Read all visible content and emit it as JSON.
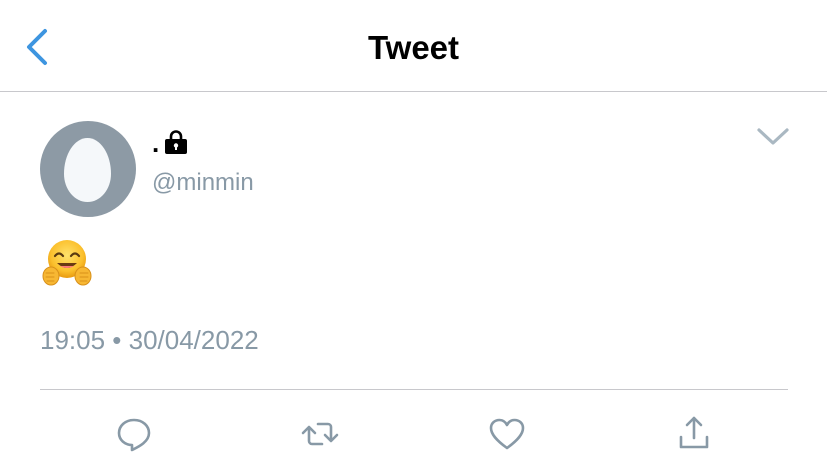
{
  "header": {
    "title": "Tweet",
    "back_icon": "chevron-left-icon",
    "accent_color": "#3d95e0"
  },
  "tweet": {
    "display_name": ".",
    "protected_icon": "lock-icon",
    "handle": "@minmin",
    "more_icon": "chevron-down-icon",
    "text_emoji": "hugging-face-emoji",
    "time": "19:05",
    "separator": "•",
    "date": "30/04/2022",
    "timestamp": "19:05 • 30/04/2022",
    "avatar": "default-egg-avatar"
  },
  "actions": [
    {
      "name": "reply",
      "icon": "comment-icon"
    },
    {
      "name": "retweet",
      "icon": "retweet-icon"
    },
    {
      "name": "like",
      "icon": "heart-icon"
    },
    {
      "name": "share",
      "icon": "share-icon"
    }
  ],
  "colors": {
    "secondary_text": "#8899a6",
    "icon_gray": "#8899a6",
    "divider": "#c8c8cc",
    "avatar_bg": "#8d9aa5"
  }
}
